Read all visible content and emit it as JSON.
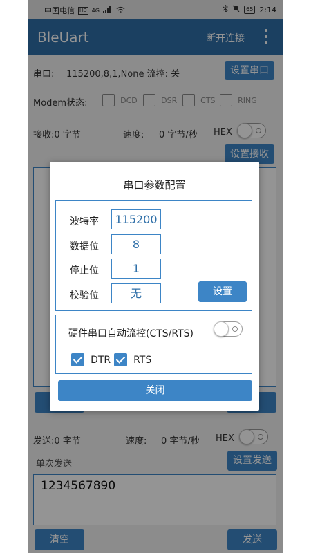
{
  "status_bar": {
    "carrier": "中国电信",
    "hd": "HD",
    "network": "4G",
    "battery": "65",
    "time": "2:14"
  },
  "app_bar": {
    "title": "BleUart",
    "disconnect_label": "断开连接"
  },
  "serial": {
    "label": "串口:",
    "value": "115200,8,1,None 流控: 关",
    "button": "设置串口"
  },
  "modem": {
    "label": "Modem状态:",
    "signals": [
      "DCD",
      "DSR",
      "CTS",
      "RING"
    ]
  },
  "receive": {
    "label": "接收:0 字节",
    "speed_label": "速度:",
    "speed_value": "0 字节/秒",
    "hex_label": "HEX",
    "button": "设置接收"
  },
  "dialog": {
    "title": "串口参数配置",
    "baud_label": "波特率",
    "baud_value": "115200",
    "data_bits_label": "数据位",
    "data_bits_value": "8",
    "stop_bits_label": "停止位",
    "stop_bits_value": "1",
    "parity_label": "校验位",
    "parity_value": "无",
    "set_button": "设置",
    "flow_label": "硬件串口自动流控(CTS/RTS)",
    "dtr_label": "DTR",
    "rts_label": "RTS",
    "close_button": "关闭"
  },
  "send": {
    "label": "发送:0 字节",
    "speed_label": "速度:",
    "speed_value": "0 字节/秒",
    "hex_label": "HEX",
    "single_send_label": "单次发送",
    "settings_button": "设置发送",
    "text": "1234567890",
    "clear_button": "清空",
    "send_button": "发送"
  }
}
